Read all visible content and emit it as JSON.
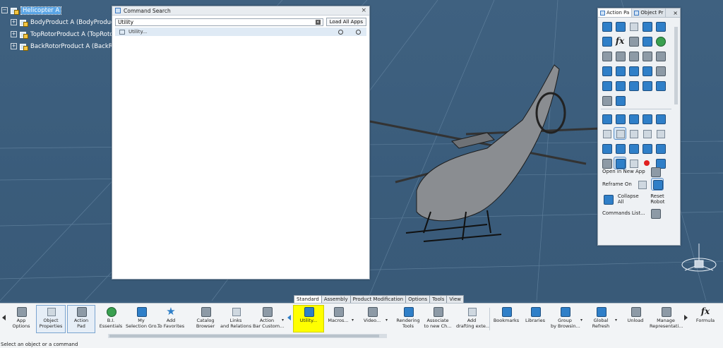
{
  "tree": {
    "root": "Helicopter A",
    "children": [
      "BodyProduct A (BodyProduct",
      "TopRotorProduct A (TopRotor",
      "BackRotorProduct A (BackRoto"
    ]
  },
  "command_search": {
    "title": "Command Search",
    "close": "×",
    "query": "Utility",
    "load_all_label": "Load All Apps",
    "results": [
      "Utility..."
    ]
  },
  "action_pad": {
    "tab_action": "Action Pa",
    "tab_object": "Object Pr",
    "close": "×",
    "open_in_new_app": "Open in New App",
    "reframe_on": "Reframe On",
    "collapse_all": "Collapse All",
    "reset_robot": "Reset Robot",
    "commands_list": "Commands List..."
  },
  "actionbar": {
    "tabs": [
      "Standard",
      "Assembly",
      "Product Modification",
      "Options",
      "Tools",
      "View"
    ],
    "active_tab": "Standard",
    "items": [
      {
        "label": "App\nOptions"
      },
      {
        "label": "Object\nProperties"
      },
      {
        "label": "Action\nPad"
      },
      {
        "label": "B.I.\nEssentials"
      },
      {
        "label": "My\nSelection Gro..."
      },
      {
        "label": "Add\nTo Favorites"
      },
      {
        "label": "Catalog\nBrowser"
      },
      {
        "label": "Links\nand Relations"
      },
      {
        "label": "Action\nBar Custom..."
      },
      {
        "label": "Utility..."
      },
      {
        "label": "Macros..."
      },
      {
        "label": "Video..."
      },
      {
        "label": "Rendering\nTools"
      },
      {
        "label": "Associate\nto new Ch..."
      },
      {
        "label": "Add\ndrafting exte..."
      },
      {
        "label": "Bookmarks"
      },
      {
        "label": "Libraries"
      },
      {
        "label": "Group\nby Browsin..."
      },
      {
        "label": "Global\nRefresh"
      },
      {
        "label": "Unload"
      },
      {
        "label": "Manage\nRepresentati..."
      },
      {
        "label": "Formula"
      }
    ]
  },
  "status": {
    "text": "Select an object or a command"
  },
  "colors": {
    "background": "#3d5f7e",
    "highlight": "#ffff00",
    "selection": "#5aa5e6"
  }
}
